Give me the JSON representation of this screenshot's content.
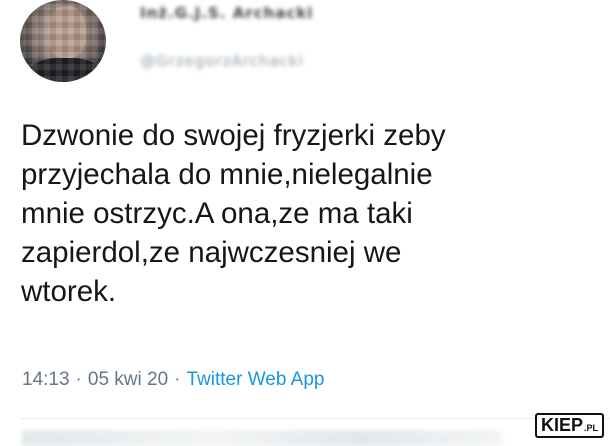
{
  "tweet": {
    "author_name": "Inż.G.J.S. Archacki",
    "author_handle": "@GrzegorzArchacki",
    "text_lines": [
      "Dzwonie do swojej fryzjerki zeby",
      "przyjechala do mnie,nielegalnie",
      "mnie ostrzyc.A ona,ze ma taki",
      "zapierdol,ze najwczesniej we",
      "wtorek."
    ],
    "time": "14:13",
    "separator": "·",
    "date": "05 kwi 20",
    "source": "Twitter Web App"
  },
  "watermark": {
    "main": "KIEP",
    "sub": ".PL"
  },
  "colors": {
    "text": "#14171a",
    "meta": "#657786",
    "link": "#1b95e0"
  }
}
